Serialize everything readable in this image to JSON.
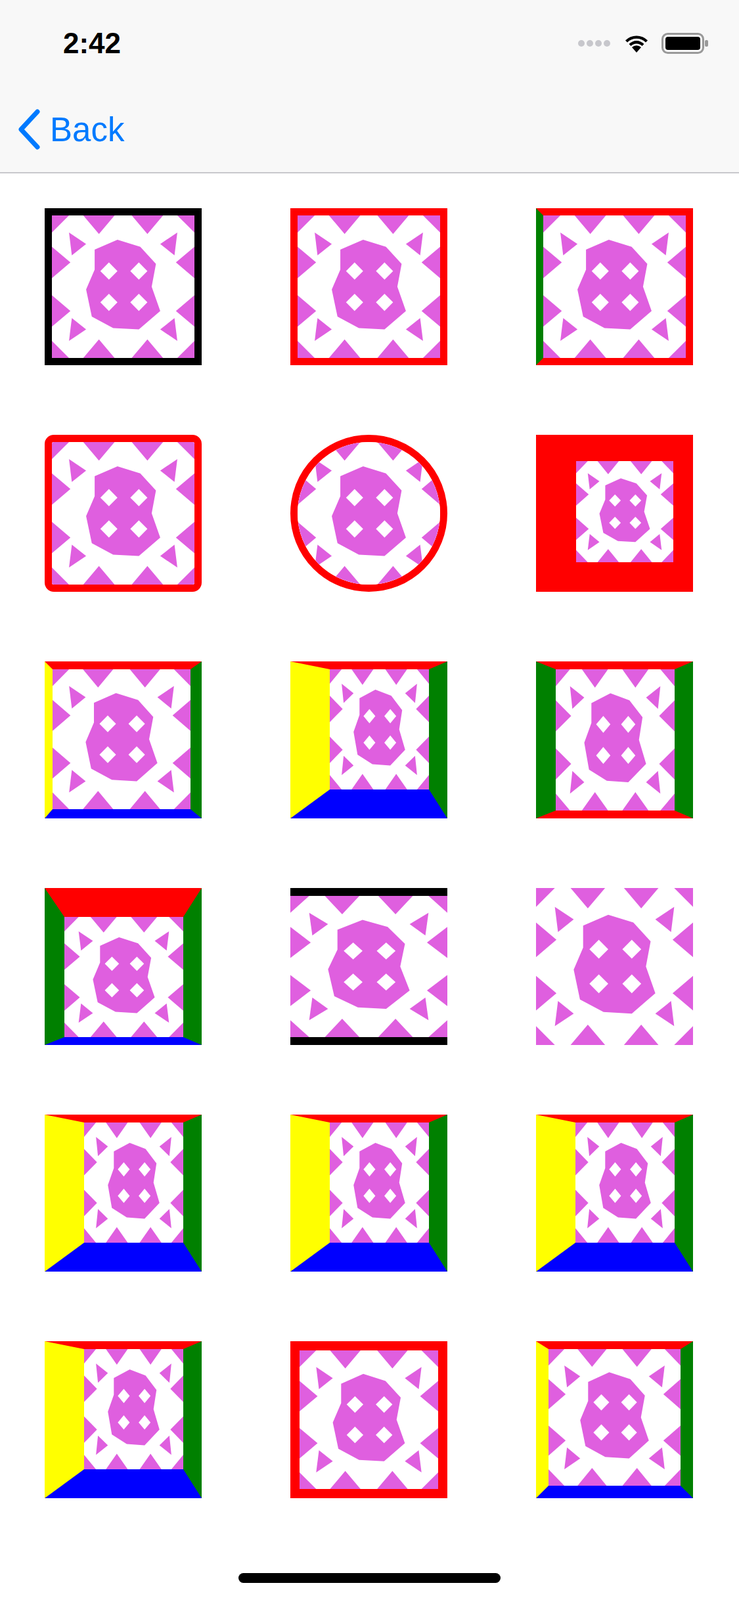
{
  "status_bar": {
    "time": "2:42"
  },
  "nav": {
    "back": "Back"
  },
  "tiles": [
    {
      "kind": "thin",
      "colors": {
        "top": "#000000",
        "right": "#000000",
        "bottom": "#000000",
        "left": "#000000"
      }
    },
    {
      "kind": "thin",
      "colors": {
        "top": "#ff0000",
        "right": "#ff0000",
        "bottom": "#ff0000",
        "left": "#ff0000"
      }
    },
    {
      "kind": "thin",
      "colors": {
        "top": "#ff0000",
        "right": "#ff0000",
        "bottom": "#ff0000",
        "left": "#008000"
      }
    },
    {
      "kind": "rounded",
      "colors": {
        "top": "#ff0000",
        "right": "#ff0000",
        "bottom": "#ff0000",
        "left": "#ff0000"
      }
    },
    {
      "kind": "circle",
      "colors": {
        "top": "#ff0000",
        "right": "#ff0000",
        "bottom": "#ff0000",
        "left": "#ff0000"
      }
    },
    {
      "kind": "heavy-left",
      "colors": {
        "top": "#ff0000",
        "right": "#ff0000",
        "bottom": "#ff0000",
        "left": "#ff0000"
      }
    },
    {
      "kind": "bevel",
      "colors": {
        "top": "#ff0000",
        "right": "#008000",
        "bottom": "#0000ff",
        "left": "#ffff00"
      }
    },
    {
      "kind": "deep",
      "colors": {
        "top": "#ff0000",
        "right": "#008000",
        "bottom": "#0000ff",
        "left": "#ffff00"
      }
    },
    {
      "kind": "sides",
      "colors": {
        "top": "#ff0000",
        "right": "#008000",
        "bottom": "#ff0000",
        "left": "#008000"
      }
    },
    {
      "kind": "top-heavy",
      "colors": {
        "top": "#ff0000",
        "right": "#008000",
        "bottom": "#0000ff",
        "left": "#008000"
      }
    },
    {
      "kind": "top-bottom",
      "colors": {
        "top": "#000000",
        "bottom": "#000000"
      }
    },
    {
      "kind": "none",
      "colors": {}
    },
    {
      "kind": "deep",
      "colors": {
        "top": "#ff0000",
        "right": "#008000",
        "bottom": "#0000ff",
        "left": "#ffff00"
      }
    },
    {
      "kind": "deep",
      "colors": {
        "top": "#ff0000",
        "right": "#008000",
        "bottom": "#0000ff",
        "left": "#ffff00"
      }
    },
    {
      "kind": "deep",
      "colors": {
        "top": "#ff0000",
        "right": "#008000",
        "bottom": "#0000ff",
        "left": "#ffff00"
      }
    },
    {
      "kind": "deep",
      "colors": {
        "top": "#ff0000",
        "right": "#008000",
        "bottom": "#0000ff",
        "left": "#ffff00"
      }
    },
    {
      "kind": "thick",
      "colors": {
        "top": "#ff0000",
        "right": "#ff0000",
        "bottom": "#ff0000",
        "left": "#ff0000"
      }
    },
    {
      "kind": "bevel-medium",
      "colors": {
        "top": "#ff0000",
        "right": "#008000",
        "bottom": "#0000ff",
        "left": "#ffff00"
      }
    }
  ]
}
